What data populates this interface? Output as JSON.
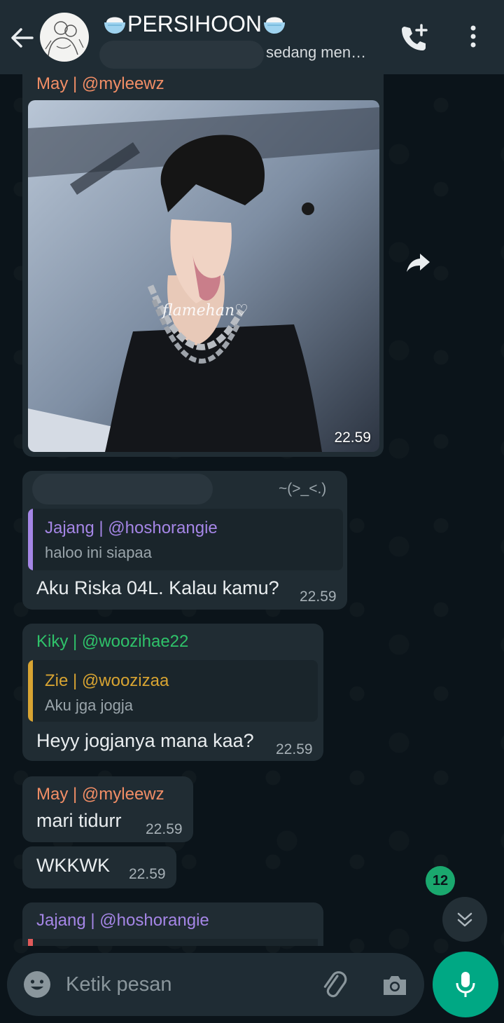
{
  "header": {
    "title": "PERSIHOON",
    "title_emoji": "rice-bowl-icon",
    "subtitle": "sedang men…",
    "bg": "#1f2c34"
  },
  "messages": [
    {
      "type": "image",
      "sender": "May | @myleewz",
      "sender_color": "#f28e66",
      "watermark": "flamehan♡",
      "time": "22.59"
    },
    {
      "type": "reply",
      "sender_tag": "~(>_<.)",
      "quote_sender": "Jajang | @hoshorangie",
      "quote_text": "haloo ini siapaa",
      "quote_color": "#a586e6",
      "text": "Aku Riska 04L. Kalau kamu?",
      "time": "22.59"
    },
    {
      "type": "reply",
      "sender": "Kiky | @woozihae22",
      "sender_color": "#2fc26a",
      "quote_sender": "Zie | @woozizaa",
      "quote_text": "Aku jga jogja",
      "quote_color": "#d8a432",
      "text": "Heyy jogjanya mana kaa?",
      "time": "22.59"
    },
    {
      "type": "text",
      "sender": "May | @myleewz",
      "sender_color": "#f28e66",
      "text": "mari tidurr",
      "time": "22.59"
    },
    {
      "type": "text",
      "text": "WKKWK",
      "time": "22.59"
    },
    {
      "type": "partial",
      "sender": "Jajang | @hoshorangie",
      "sender_color": "#a586e6"
    }
  ],
  "unread_count": "12",
  "composer": {
    "placeholder": "Ketik pesan"
  },
  "icons": [
    "back-arrow-icon",
    "add-call-icon",
    "more-vert-icon",
    "forward-icon",
    "chevron-down-icon",
    "emoji-icon",
    "attach-icon",
    "camera-icon",
    "mic-icon"
  ],
  "accent": "#00a884"
}
